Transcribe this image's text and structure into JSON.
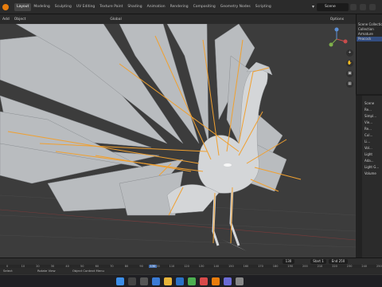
{
  "workspace_tabs": [
    "Layout",
    "Modeling",
    "Sculpting",
    "UV Editing",
    "Texture Paint",
    "Shading",
    "Animation",
    "Rendering",
    "Compositing",
    "Geometry Nodes",
    "Scripting"
  ],
  "active_tab": "Layout",
  "scene": {
    "label": "Scene"
  },
  "viewport_header": {
    "mode": "Add",
    "object_menu": "Object",
    "transform": "Global",
    "options": "Options"
  },
  "outliner": {
    "title": "Scene Collection",
    "rows": [
      "Scene Collection",
      "Collection",
      "Armature",
      "Peacock"
    ]
  },
  "properties": {
    "rows": [
      "Scene",
      "Re...",
      "Simpl...",
      "Vie...",
      "Re...",
      "Cul...",
      "Li...",
      "Vol...",
      "Light",
      "Ada...",
      "Light G...",
      "Volume"
    ]
  },
  "timeline": {
    "current_frame": "130",
    "start_label": "Start",
    "start_value": "1",
    "end_label": "End",
    "end_value": "250",
    "ticks": [
      "0",
      "10",
      "20",
      "30",
      "40",
      "50",
      "60",
      "70",
      "80",
      "90",
      "100",
      "110",
      "120",
      "130",
      "140",
      "150",
      "160",
      "170",
      "180",
      "190",
      "200",
      "210",
      "220",
      "230",
      "240",
      "250"
    ],
    "current_badge": "130"
  },
  "statusbar": {
    "left": "Select",
    "middle": "Rotate View",
    "right": "Object Context Menu"
  },
  "taskbar": {
    "time": "",
    "date": ""
  },
  "colors": {
    "accent": "#e87d0d",
    "bone": "#f0a030",
    "selection": "#4772b3"
  }
}
